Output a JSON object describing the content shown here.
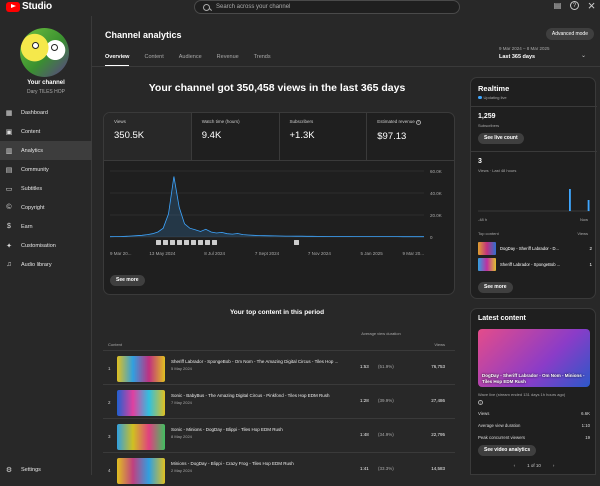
{
  "app": {
    "logo_text": "Studio",
    "search_placeholder": "Search across your channel"
  },
  "icons": {
    "search": "search-icon",
    "comments": "comment-icon",
    "help": "help-icon",
    "close": "close-icon"
  },
  "channel": {
    "title": "Your channel",
    "name": "Dary TILES HOP"
  },
  "nav": [
    {
      "label": "Dashboard",
      "icon": "dashboard-icon",
      "glyph": "▦"
    },
    {
      "label": "Content",
      "icon": "content-icon",
      "glyph": "▣"
    },
    {
      "label": "Analytics",
      "icon": "analytics-icon",
      "glyph": "▥"
    },
    {
      "label": "Community",
      "icon": "community-icon",
      "glyph": "▤"
    },
    {
      "label": "Subtitles",
      "icon": "subtitles-icon",
      "glyph": "▭"
    },
    {
      "label": "Copyright",
      "icon": "copyright-icon",
      "glyph": "©"
    },
    {
      "label": "Earn",
      "icon": "earn-icon",
      "glyph": "$"
    },
    {
      "label": "Customisation",
      "icon": "customisation-icon",
      "glyph": "✦"
    },
    {
      "label": "Audio library",
      "icon": "audio-library-icon",
      "glyph": "♫"
    }
  ],
  "settings_label": "Settings",
  "page": {
    "title": "Channel analytics",
    "advanced_mode": "Advanced mode",
    "tabs": [
      "Overview",
      "Content",
      "Audience",
      "Revenue",
      "Trends"
    ],
    "date_range_small": "9 Mar 2024 – 8 Mar 2025",
    "date_range": "Last 365 days",
    "headline": "Your channel got 350,458 views in the last 365 days"
  },
  "metrics": [
    {
      "label": "Views",
      "value": "350.5K"
    },
    {
      "label": "Watch time (hours)",
      "value": "9.4K"
    },
    {
      "label": "Subscribers",
      "value": "+1.3K"
    },
    {
      "label": "Estimated revenue",
      "value": "$97.13"
    }
  ],
  "chart_data": {
    "type": "area",
    "y_ticks": [
      "60.0K",
      "40.0K",
      "20.0K",
      "0"
    ],
    "x_ticks": [
      "9 Mar 20...",
      "13 May 2024",
      "8 Jul 2024",
      "7 Sept 2024",
      "7 Nov 2024",
      "5 Jan 2025",
      "9 Mar 20..."
    ],
    "ylim": [
      0,
      60000
    ],
    "values": [
      300,
      400,
      500,
      600,
      900,
      1200,
      1500,
      2200,
      3000,
      4500,
      8000,
      21000,
      55000,
      27000,
      12000,
      8000,
      6500,
      5000,
      7000,
      4500,
      3600,
      4200,
      3000,
      2600,
      3200,
      2200,
      1800,
      1500,
      1300,
      1200,
      1100,
      1000,
      900,
      850,
      800,
      750,
      700,
      650,
      600,
      560,
      520,
      500,
      480,
      460,
      440,
      420,
      400,
      390,
      380,
      370,
      360,
      350,
      340,
      330,
      320,
      310,
      300,
      290,
      280,
      270
    ]
  },
  "see_more": "See more",
  "top_content": {
    "title": "Your top content in this period",
    "col_content": "Content",
    "col_avg": "Average view duration",
    "col_views": "Views",
    "rows": [
      {
        "idx": "1",
        "title": "Sheriff Labrador - SpongeBob - Om Nom - The Amazing Digital Circus - Tiles Hop ...",
        "date": "5 May 2024",
        "dur": "1:53",
        "pct": "(51.9%)",
        "views": "76,753"
      },
      {
        "idx": "2",
        "title": "Sonic - BabyBus - The Amazing Digital Circus - Pinkfond - Tiles Hop EDM Rush",
        "date": "7 May 2024",
        "dur": "1:28",
        "pct": "(39.9%)",
        "views": "27,486"
      },
      {
        "idx": "3",
        "title": "Sonic - Minions - DogDay - Blippi - Tiles Hop EDM Rush",
        "date": "8 May 2024",
        "dur": "1:48",
        "pct": "(34.9%)",
        "views": "22,795"
      },
      {
        "idx": "4",
        "title": "Minions - DogDay - Blippi - Crazy Frog - Tiles Hop EDM Rush",
        "date": "2 May 2024",
        "dur": "1:41",
        "pct": "(33.3%)",
        "views": "14,583"
      }
    ]
  },
  "realtime": {
    "title": "Realtime",
    "live": "Updating live",
    "subs_value": "1,259",
    "subs_label": "Subscribers",
    "see_live": "See live count",
    "views_value": "3",
    "views_label": "Views · Last 48 hours",
    "axis_left": "-48 h",
    "axis_right": "Now",
    "bars": [
      0,
      0,
      0,
      0,
      0,
      0,
      0,
      0,
      0,
      0,
      0,
      0,
      0,
      0,
      0,
      0,
      0,
      0,
      0,
      0,
      0,
      0,
      0,
      0,
      0,
      0,
      0,
      0,
      0,
      0,
      0,
      0,
      0,
      0,
      0,
      0,
      0,
      0,
      0,
      2,
      0,
      0,
      0,
      0,
      0,
      0,
      0,
      1
    ],
    "top_label": "Top content",
    "top_views_label": "Views",
    "items": [
      {
        "title": "DogDay - Sheriff Labrador - D...",
        "views": "2"
      },
      {
        "title": "Sheriff Labrador - SpongeBob ...",
        "views": "1"
      }
    ]
  },
  "latest": {
    "title": "Latest content",
    "caption": "DogDay - Sheriff Labrador - Om Nom - Minions - Tiles Hop EDM Rush",
    "meta": "Wave live (stream ended 131 days 1h hours ago)",
    "stats": [
      {
        "label": "Views",
        "value": "6.6K"
      },
      {
        "label": "Average view duration",
        "value": "1:10"
      },
      {
        "label": "Peak concurrent viewers",
        "value": "19"
      }
    ],
    "see_analytics": "See video analytics",
    "pager": "1 of 10"
  }
}
